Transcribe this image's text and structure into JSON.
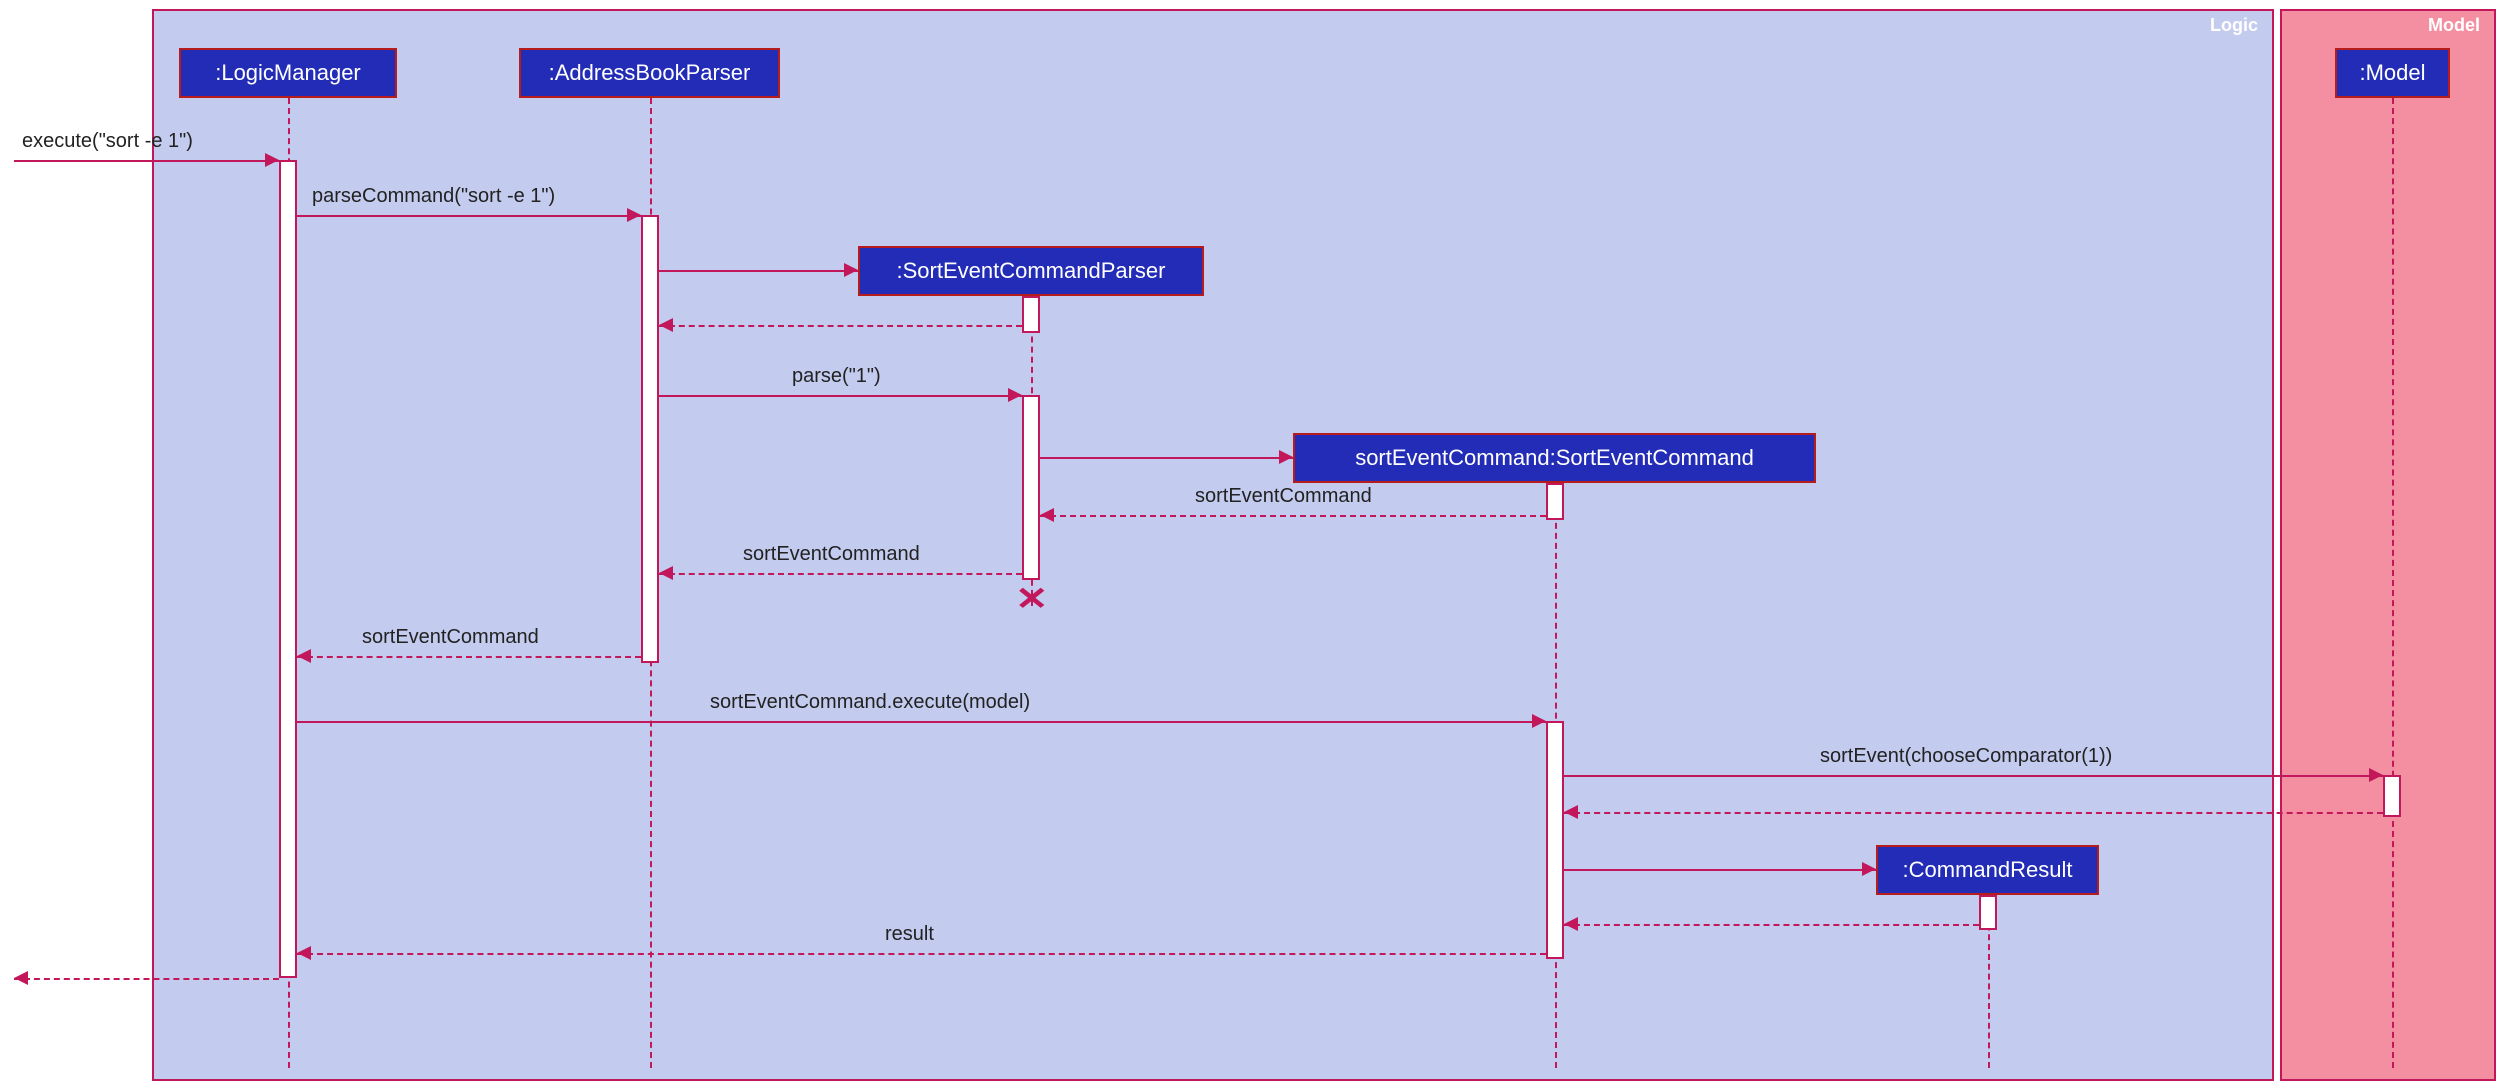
{
  "frames": {
    "logic": "Logic",
    "model": "Model"
  },
  "participants": {
    "logicManager": ":LogicManager",
    "addressBookParser": ":AddressBookParser",
    "sortEventCommandParser": ":SortEventCommandParser",
    "sortEventCommand": "sortEventCommand:SortEventCommand",
    "model": ":Model",
    "commandResult": ":CommandResult"
  },
  "messages": {
    "m1": "execute(\"sort -e 1\")",
    "m2": "parseCommand(\"sort -e 1\")",
    "m3": "parse(\"1\")",
    "m4": "sortEventCommand",
    "m5": "sortEventCommand",
    "m6": "sortEventCommand",
    "m7": "sortEventCommand.execute(model)",
    "m8": "sortEvent(chooseComparator(1))",
    "m9": "result"
  }
}
